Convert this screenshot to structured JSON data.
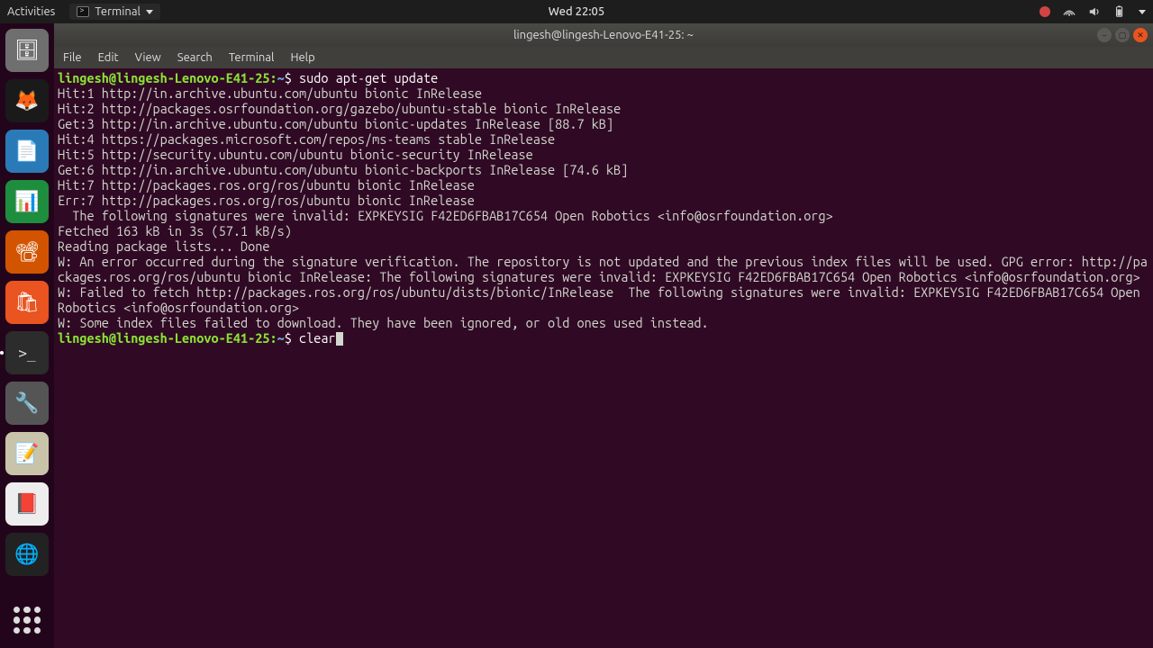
{
  "topbar": {
    "activities": "Activities",
    "app_name": "Terminal",
    "clock": "Wed 22:05"
  },
  "launcher": {
    "items": [
      {
        "name": "files-icon",
        "bg": "#6f6f6f",
        "glyph": "🗄"
      },
      {
        "name": "firefox-icon",
        "bg": "#1a1a1a",
        "glyph": "🦊"
      },
      {
        "name": "writer-icon",
        "bg": "#2b7ab8",
        "glyph": "📄"
      },
      {
        "name": "calc-icon",
        "bg": "#1e8e3e",
        "glyph": "📊"
      },
      {
        "name": "impress-icon",
        "bg": "#d35400",
        "glyph": "📽"
      },
      {
        "name": "software-icon",
        "bg": "#e95420",
        "glyph": "🛍"
      },
      {
        "name": "terminal-icon",
        "bg": "#2c2c2c",
        "glyph": ">_",
        "active": true
      },
      {
        "name": "settings-icon",
        "bg": "#555",
        "glyph": "🔧"
      },
      {
        "name": "text-editor-icon",
        "bg": "#c9c4a9",
        "glyph": "📝"
      },
      {
        "name": "document-viewer-icon",
        "bg": "#eee",
        "glyph": "📕"
      },
      {
        "name": "browser-icon",
        "bg": "#222",
        "glyph": "🌐"
      }
    ]
  },
  "window": {
    "title": "lingesh@lingesh-Lenovo-E41-25: ~",
    "menus": [
      "File",
      "Edit",
      "View",
      "Search",
      "Terminal",
      "Help"
    ]
  },
  "prompt": {
    "userhost": "lingesh@lingesh-Lenovo-E41-25",
    "sep": ":",
    "path": "~",
    "sigil": "$"
  },
  "terminal": {
    "cmd1": "sudo apt-get update",
    "lines": [
      "Hit:1 http://in.archive.ubuntu.com/ubuntu bionic InRelease",
      "Hit:2 http://packages.osrfoundation.org/gazebo/ubuntu-stable bionic InRelease",
      "Get:3 http://in.archive.ubuntu.com/ubuntu bionic-updates InRelease [88.7 kB]",
      "Hit:4 https://packages.microsoft.com/repos/ms-teams stable InRelease",
      "Hit:5 http://security.ubuntu.com/ubuntu bionic-security InRelease",
      "Get:6 http://in.archive.ubuntu.com/ubuntu bionic-backports InRelease [74.6 kB]",
      "Hit:7 http://packages.ros.org/ros/ubuntu bionic InRelease",
      "Err:7 http://packages.ros.org/ros/ubuntu bionic InRelease",
      "  The following signatures were invalid: EXPKEYSIG F42ED6FBAB17C654 Open Robotics <info@osrfoundation.org>",
      "Fetched 163 kB in 3s (57.1 kB/s)",
      "Reading package lists... Done",
      "W: An error occurred during the signature verification. The repository is not updated and the previous index files will be used. GPG error: http://packages.ros.org/ros/ubuntu bionic InRelease: The following signatures were invalid: EXPKEYSIG F42ED6FBAB17C654 Open Robotics <info@osrfoundation.org>",
      "W: Failed to fetch http://packages.ros.org/ros/ubuntu/dists/bionic/InRelease  The following signatures were invalid: EXPKEYSIG F42ED6FBAB17C654 Open Robotics <info@osrfoundation.org>",
      "W: Some index files failed to download. They have been ignored, or old ones used instead."
    ],
    "cmd2": "clear"
  }
}
